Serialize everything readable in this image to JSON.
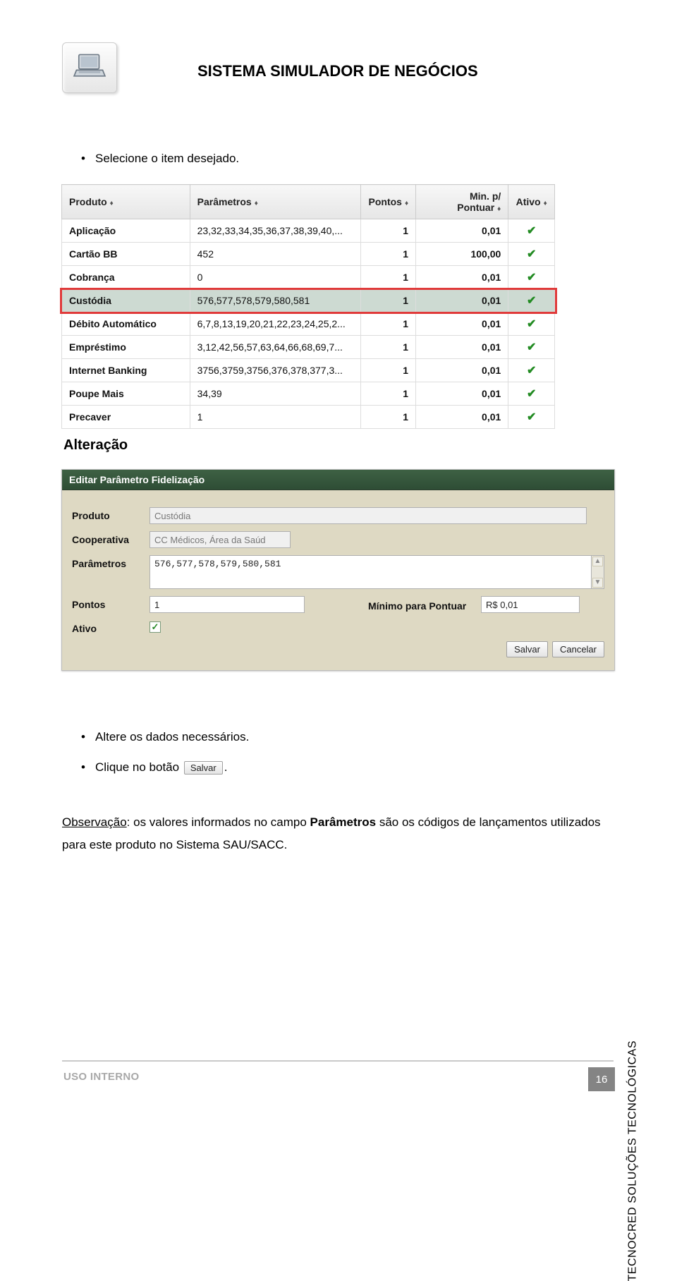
{
  "header": {
    "title": "SISTEMA SIMULADOR DE NEGÓCIOS"
  },
  "instructions": {
    "select_item": "Selecione o item desejado.",
    "alter_data": "Altere os dados necessários.",
    "click_button_prefix": "Clique no botão",
    "click_button_suffix": ".",
    "salvar_chip": "Salvar"
  },
  "table": {
    "columns": {
      "produto": "Produto",
      "parametros": "Parâmetros",
      "pontos": "Pontos",
      "min": "Min. p/ Pontuar",
      "ativo": "Ativo"
    },
    "rows": [
      {
        "produto": "Aplicação",
        "parametros": "23,32,33,34,35,36,37,38,39,40,...",
        "pontos": "1",
        "min": "0,01",
        "ativo": true,
        "highlight": false
      },
      {
        "produto": "Cartão BB",
        "parametros": "452",
        "pontos": "1",
        "min": "100,00",
        "ativo": true,
        "highlight": false
      },
      {
        "produto": "Cobrança",
        "parametros": "0",
        "pontos": "1",
        "min": "0,01",
        "ativo": true,
        "highlight": false
      },
      {
        "produto": "Custódia",
        "parametros": "576,577,578,579,580,581",
        "pontos": "1",
        "min": "0,01",
        "ativo": true,
        "highlight": true
      },
      {
        "produto": "Débito Automático",
        "parametros": "6,7,8,13,19,20,21,22,23,24,25,2...",
        "pontos": "1",
        "min": "0,01",
        "ativo": true,
        "highlight": false
      },
      {
        "produto": "Empréstimo",
        "parametros": "3,12,42,56,57,63,64,66,68,69,7...",
        "pontos": "1",
        "min": "0,01",
        "ativo": true,
        "highlight": false
      },
      {
        "produto": "Internet Banking",
        "parametros": "3756,3759,3756,376,378,377,3...",
        "pontos": "1",
        "min": "0,01",
        "ativo": true,
        "highlight": false
      },
      {
        "produto": "Poupe Mais",
        "parametros": "34,39",
        "pontos": "1",
        "min": "0,01",
        "ativo": true,
        "highlight": false
      },
      {
        "produto": "Precaver",
        "parametros": "1",
        "pontos": "1",
        "min": "0,01",
        "ativo": true,
        "highlight": false
      }
    ]
  },
  "section": {
    "alteracao_heading": "Alteração"
  },
  "editPanel": {
    "title": "Editar Parâmetro Fidelização",
    "labels": {
      "produto": "Produto",
      "cooperativa": "Cooperativa",
      "parametros": "Parâmetros",
      "pontos": "Pontos",
      "minimo": "Mínimo para Pontuar",
      "ativo": "Ativo"
    },
    "values": {
      "produto": "Custódia",
      "cooperativa": "CC Médicos, Área da Saúd",
      "parametros": "576,577,578,579,580,581",
      "pontos": "1",
      "minimo": "R$ 0,01",
      "ativo_checked": true
    },
    "buttons": {
      "salvar": "Salvar",
      "cancelar": "Cancelar"
    }
  },
  "observation": {
    "prefix": "Observação",
    "mid1": ": os valores informados no campo ",
    "bold": "Parâmetros",
    "mid2": " são os códigos de lançamentos utilizados para este produto no Sistema SAU/SACC."
  },
  "sideText": "TECNOCRED SOLUÇÕES TECNOLÓGICAS",
  "footer": {
    "left": "USO INTERNO",
    "page": "16"
  }
}
